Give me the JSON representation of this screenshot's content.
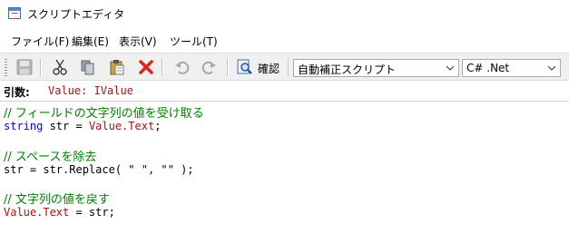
{
  "window": {
    "title": "スクリプトエディタ"
  },
  "menu": [
    "ファイル(F)",
    "編集(E)",
    "表示(V)",
    "ツール(T)"
  ],
  "toolbar": {
    "confirm_label": "確認",
    "script_select": {
      "selected": "自動補正スクリプト"
    },
    "language_select": {
      "selected": "C# .Net"
    }
  },
  "arguments": {
    "label": "引数:",
    "value": "Value: IValue"
  },
  "code": {
    "comment1": "// フィールドの文字列の値を受け取る",
    "line1_kw": "string",
    "line1_rest": " str = ",
    "line1_prop": "Value.Text",
    "line1_end": ";",
    "comment2": "// スペースを除去",
    "line2": "str = str.Replace( \" \", \"\" );",
    "comment3": "// 文字列の値を戻す",
    "line3_prop": "Value.Text",
    "line3_rest": " = str;"
  }
}
